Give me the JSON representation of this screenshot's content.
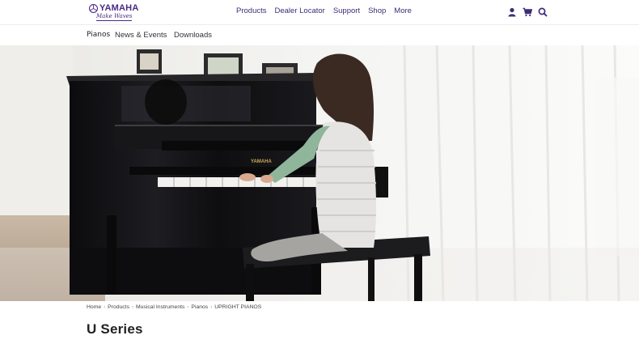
{
  "brand": {
    "name": "YAMAHA",
    "tagline": "Make Waves",
    "accent": "#4b2a82"
  },
  "mainnav": {
    "items": [
      {
        "label": "Products"
      },
      {
        "label": "Dealer Locator"
      },
      {
        "label": "Support"
      },
      {
        "label": "Shop"
      },
      {
        "label": "More"
      }
    ]
  },
  "utility": {
    "icons": [
      "user-icon",
      "cart-icon",
      "search-icon"
    ]
  },
  "subnav": {
    "items": [
      {
        "label": "Pianos"
      },
      {
        "label": "News & Events"
      },
      {
        "label": "Downloads"
      }
    ]
  },
  "hero": {
    "piano_label": "YAMAHA"
  },
  "breadcrumb": {
    "items": [
      {
        "label": "Home"
      },
      {
        "label": "Products"
      },
      {
        "label": "Musical Instruments"
      },
      {
        "label": "Pianos"
      },
      {
        "label": "UPRIGHT PIANOS"
      }
    ]
  },
  "page": {
    "title": "U Series"
  }
}
